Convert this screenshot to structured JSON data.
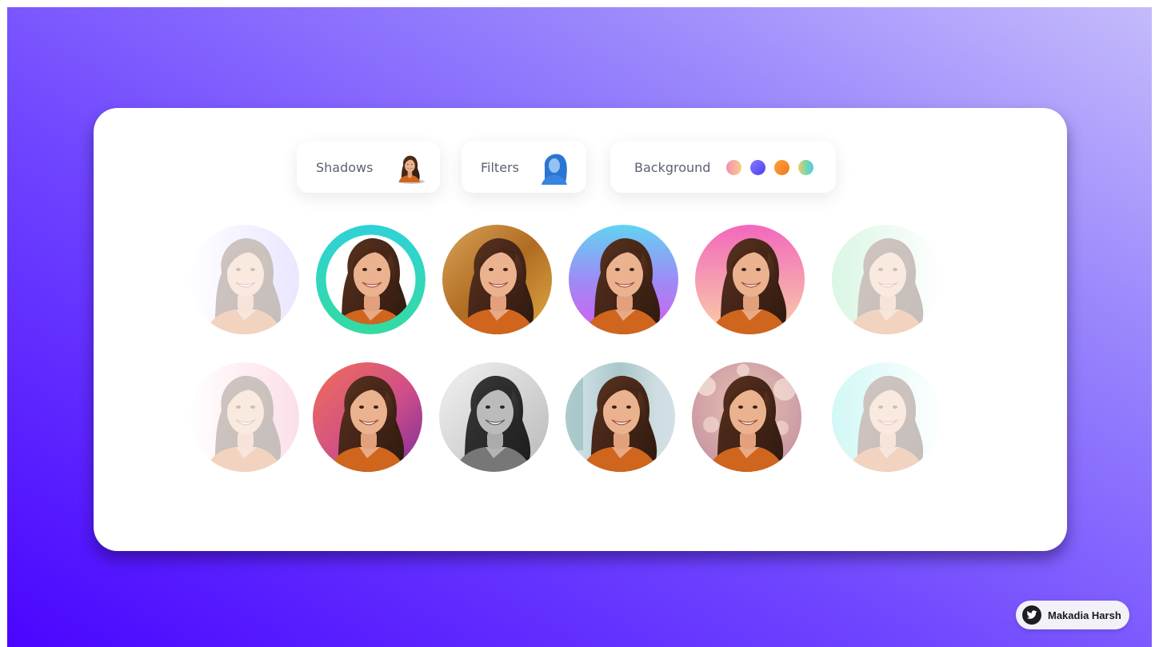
{
  "toolbar": {
    "shadows_label": "Shadows",
    "filters_label": "Filters",
    "background_label": "Background",
    "background_swatches": [
      {
        "name": "peach-pink",
        "colors": [
          "#f58fb0",
          "#f6cf8a"
        ]
      },
      {
        "name": "violet",
        "colors": [
          "#8a7bff",
          "#4b3df1"
        ]
      },
      {
        "name": "orange",
        "colors": [
          "#fca23b",
          "#f0781a"
        ]
      },
      {
        "name": "rainbow",
        "colors": [
          "#f7c86f",
          "#77d9a6",
          "#58c6e7"
        ]
      }
    ]
  },
  "avatars": {
    "row1": [
      {
        "style": "lavender-fade",
        "faded": true
      },
      {
        "style": "teal-ring",
        "faded": false
      },
      {
        "style": "golden-texture",
        "faded": false
      },
      {
        "style": "blue-purple-gradient",
        "faded": false
      },
      {
        "style": "pink-peach-gradient",
        "faded": false
      },
      {
        "style": "mint-fade",
        "faded": true
      }
    ],
    "row2": [
      {
        "style": "pink-fade",
        "faded": true
      },
      {
        "style": "red-purple-gradient",
        "faded": false
      },
      {
        "style": "grayscale",
        "faded": false
      },
      {
        "style": "blurred-street",
        "faded": false
      },
      {
        "style": "bokeh-lights",
        "faded": false
      },
      {
        "style": "cyan-fade",
        "faded": true
      }
    ]
  },
  "credit": {
    "name": "Makadia Harsh",
    "icon": "twitter-bird-icon"
  }
}
